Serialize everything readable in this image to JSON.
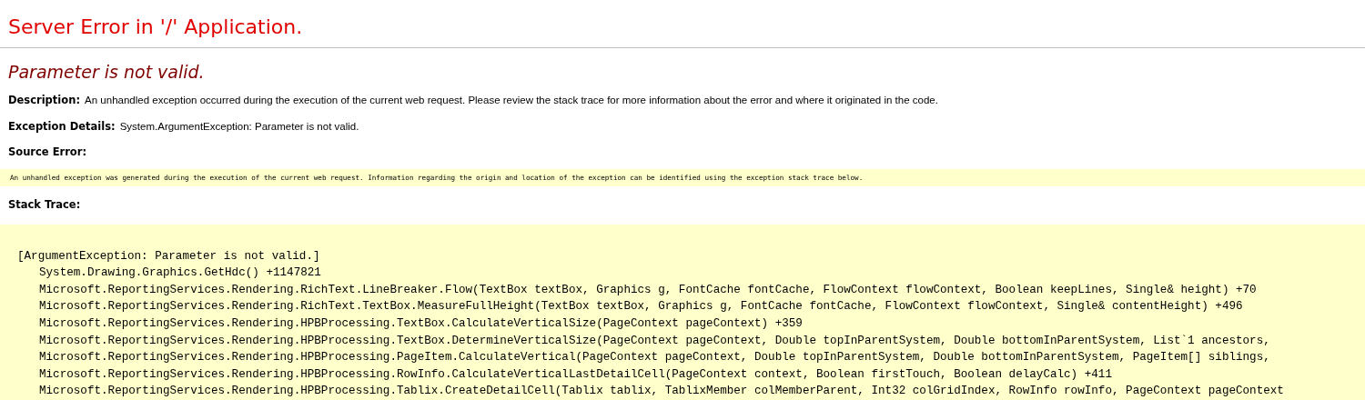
{
  "page_title": "Server Error in '/' Application.",
  "error_message": "Parameter is not valid.",
  "details": [
    {
      "label": "Description:",
      "text": "An unhandled exception occurred during the execution of the current web request. Please review the stack trace for more information about the error and where it originated in the code."
    },
    {
      "label": "Exception Details:",
      "text": "System.ArgumentException: Parameter is not valid."
    }
  ],
  "source_error": {
    "label": "Source Error:",
    "text": "An unhandled exception was generated during the execution of the current web request. Information regarding the origin and location of the exception can be identified using the exception stack trace below."
  },
  "stack_trace": {
    "label": "Stack Trace:",
    "lines": [
      {
        "text": "[ArgumentException: Parameter is not valid.]",
        "children": [
          {
            "text": "System.Drawing.Graphics.GetHdc() +1147821"
          },
          {
            "text": "Microsoft.ReportingServices.Rendering.RichText.LineBreaker.Flow(TextBox textBox, Graphics g, FontCache fontCache, FlowContext flowContext, Boolean keepLines, Single& height) +70"
          },
          {
            "text": "Microsoft.ReportingServices.Rendering.RichText.TextBox.MeasureFullHeight(TextBox textBox, Graphics g, FontCache fontCache, FlowContext flowContext, Single& contentHeight) +496"
          },
          {
            "text": "Microsoft.ReportingServices.Rendering.HPBProcessing.TextBox.CalculateVerticalSize(PageContext pageContext) +359"
          },
          {
            "text": "Microsoft.ReportingServices.Rendering.HPBProcessing.TextBox.DetermineVerticalSize(PageContext pageContext, Double topInParentSystem, Double bottomInParentSystem, List`1 ancestors,"
          },
          {
            "text": "Microsoft.ReportingServices.Rendering.HPBProcessing.PageItem.CalculateVertical(PageContext pageContext, Double topInParentSystem, Double bottomInParentSystem, PageItem[] siblings,"
          },
          {
            "text": "Microsoft.ReportingServices.Rendering.HPBProcessing.RowInfo.CalculateVerticalLastDetailCell(PageContext context, Boolean firstTouch, Boolean delayCalc) +411"
          },
          {
            "text": "Microsoft.ReportingServices.Rendering.HPBProcessing.Tablix.CreateDetailCell(Tablix tablix, TablixMember colMemberParent, Int32 colGridIndex, RowInfo rowInfo, PageContext pageContext"
          }
        ]
      }
    ]
  }
}
